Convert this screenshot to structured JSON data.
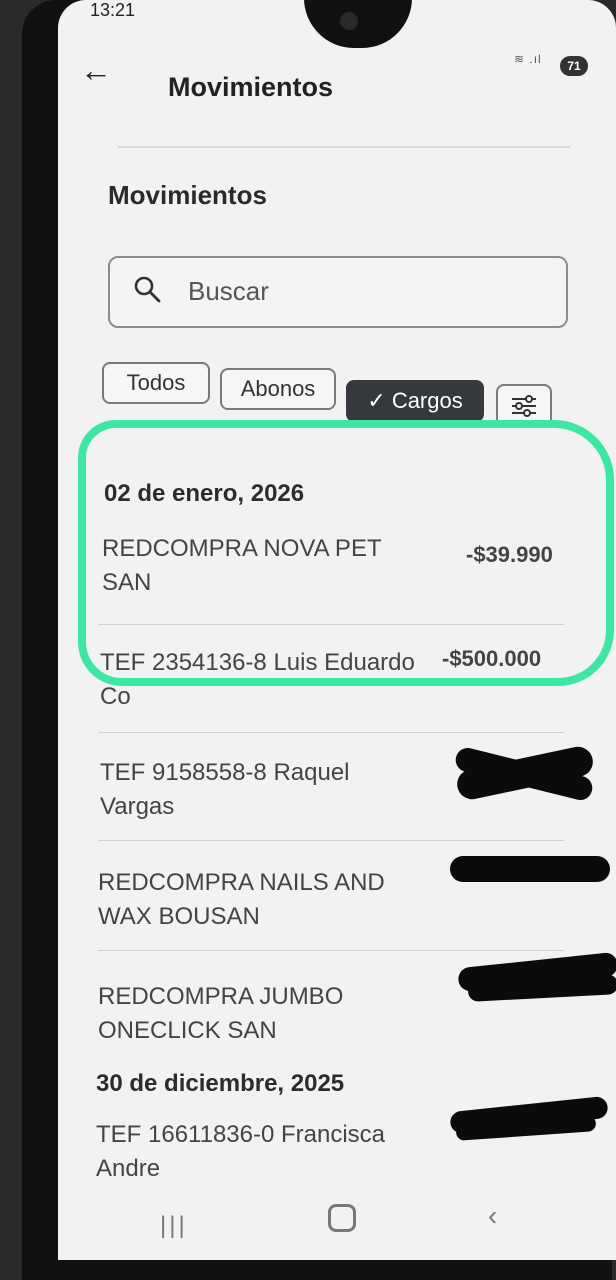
{
  "status": {
    "time": "13:21",
    "signal": "wifi lte",
    "battery": "71"
  },
  "header": {
    "title": "Movimientos"
  },
  "section": {
    "title": "Movimientos"
  },
  "search": {
    "placeholder": "Buscar"
  },
  "filters": {
    "all": "Todos",
    "credits": "Abonos",
    "charges": "Cargos",
    "charges_checkmark": "✓"
  },
  "groups": [
    {
      "date": "02 de enero, 2026",
      "transactions": [
        {
          "description": "REDCOMPRA NOVA PET SAN",
          "amount": "-$39.990"
        },
        {
          "description": "TEF 2354136-8 Luis Eduardo Co",
          "amount": "-$500.000"
        },
        {
          "description": "TEF 9158558-8 Raquel Vargas",
          "amount": "[redacted]"
        },
        {
          "description": "REDCOMPRA NAILS AND WAX BOUSAN",
          "amount": "[redacted]"
        },
        {
          "description": "REDCOMPRA JUMBO ONECLICK SAN",
          "amount": "[redacted]"
        }
      ]
    },
    {
      "date": "30 de diciembre, 2025",
      "transactions": [
        {
          "description": "TEF 16611836-0 Francisca Andre",
          "amount": "[redacted]"
        }
      ]
    }
  ],
  "colors": {
    "highlight": "#3de6a3",
    "chip_active": "#35383c",
    "background": "#f1f2f1"
  },
  "icons": [
    "back-arrow-icon",
    "search-icon",
    "check-icon",
    "filter-sliders-icon",
    "wifi-icon",
    "signal-icon",
    "recent-apps-icon",
    "home-icon",
    "nav-back-icon"
  ]
}
